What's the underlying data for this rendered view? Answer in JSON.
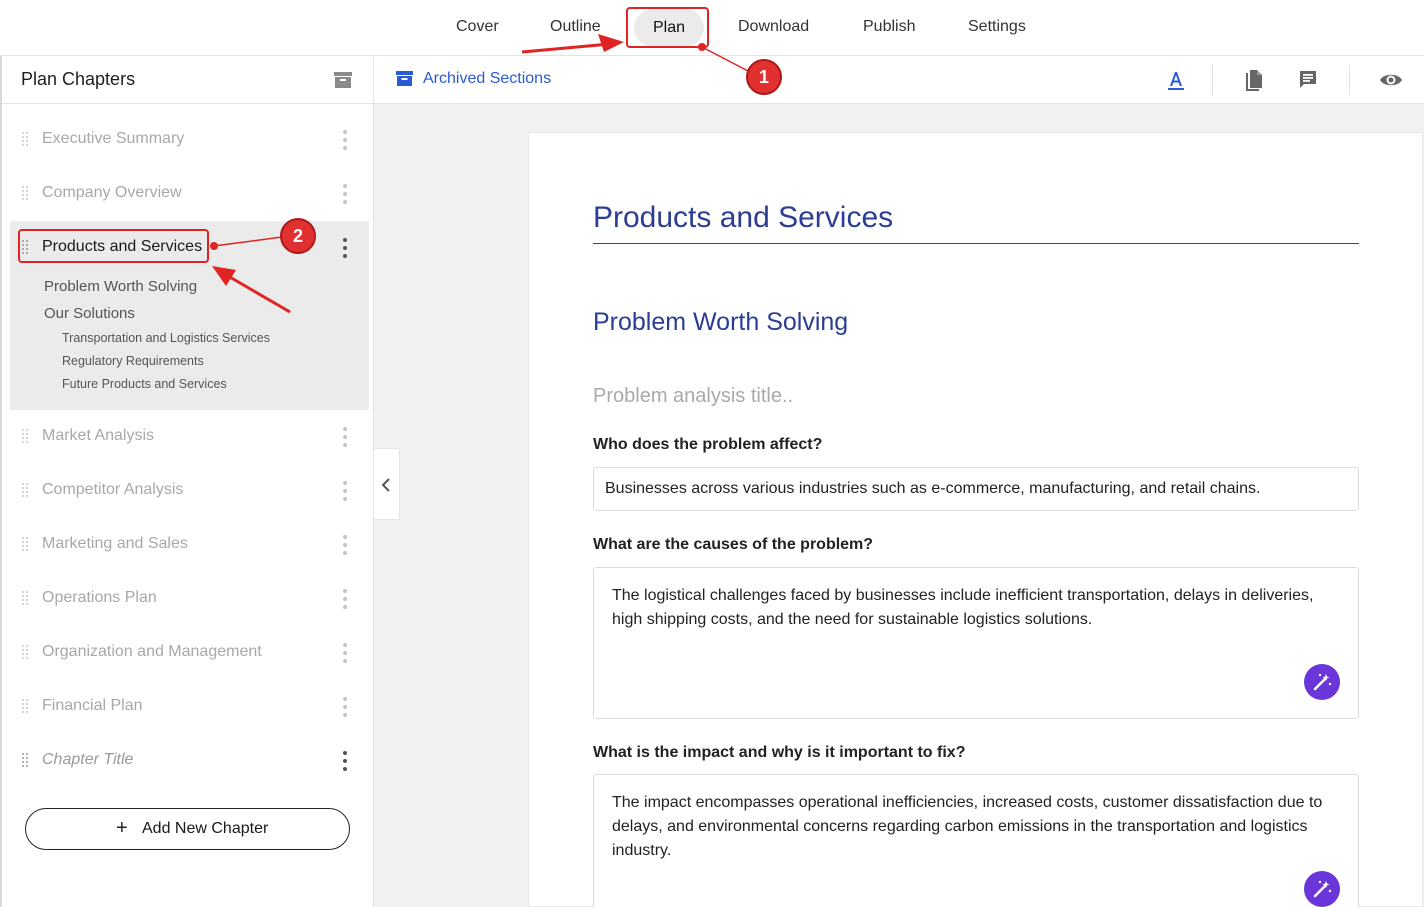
{
  "topnav": {
    "tabs": [
      {
        "label": "Cover"
      },
      {
        "label": "Outline"
      },
      {
        "label": "Plan"
      },
      {
        "label": "Download"
      },
      {
        "label": "Publish"
      },
      {
        "label": "Settings"
      }
    ],
    "active_tab": "Plan"
  },
  "sidebar": {
    "title": "Plan Chapters",
    "chapters": [
      {
        "label": "Executive Summary"
      },
      {
        "label": "Company Overview"
      },
      {
        "label": "Products and Services"
      },
      {
        "label": "Market Analysis"
      },
      {
        "label": "Competitor Analysis"
      },
      {
        "label": "Marketing and Sales"
      },
      {
        "label": "Operations Plan"
      },
      {
        "label": "Organization and Management"
      },
      {
        "label": "Financial Plan"
      },
      {
        "label": "Chapter Title"
      }
    ],
    "active_sections": [
      {
        "label": "Problem Worth Solving"
      },
      {
        "label": "Our Solutions"
      }
    ],
    "active_subsections": [
      {
        "label": "Transportation and Logistics Services"
      },
      {
        "label": "Regulatory Requirements"
      },
      {
        "label": "Future Products and Services"
      }
    ],
    "add_button_label": "Add New Chapter"
  },
  "toolbar": {
    "archived_link": "Archived Sections",
    "icons": [
      "text-format-icon",
      "document-icon",
      "comment-icon",
      "eye-icon"
    ]
  },
  "document": {
    "chapter_title": "Products and Services",
    "section_title": "Problem Worth Solving",
    "analysis_title_placeholder": "Problem analysis title..",
    "questions": [
      {
        "label": "Who does the problem affect?",
        "answer": "Businesses across various industries such as e-commerce, manufacturing, and retail chains."
      },
      {
        "label": "What are the causes of the problem?",
        "answer": "The logistical challenges faced by businesses include inefficient transportation, delays in deliveries, high shipping costs, and the need for sustainable logistics solutions."
      },
      {
        "label": "What is the impact and why is it important to fix?",
        "answer": "The impact encompasses operational inefficiencies, increased costs, customer dissatisfaction due to delays, and environmental concerns regarding carbon emissions in the transportation and logistics industry."
      }
    ]
  },
  "annotations": {
    "badge_1": "1",
    "badge_2": "2",
    "color": "#e02424"
  },
  "colors": {
    "heading": "#2b3e93",
    "link": "#2a5bd7",
    "magic_button": "#6a35d9",
    "active_chapter_bg": "#ebebeb"
  }
}
